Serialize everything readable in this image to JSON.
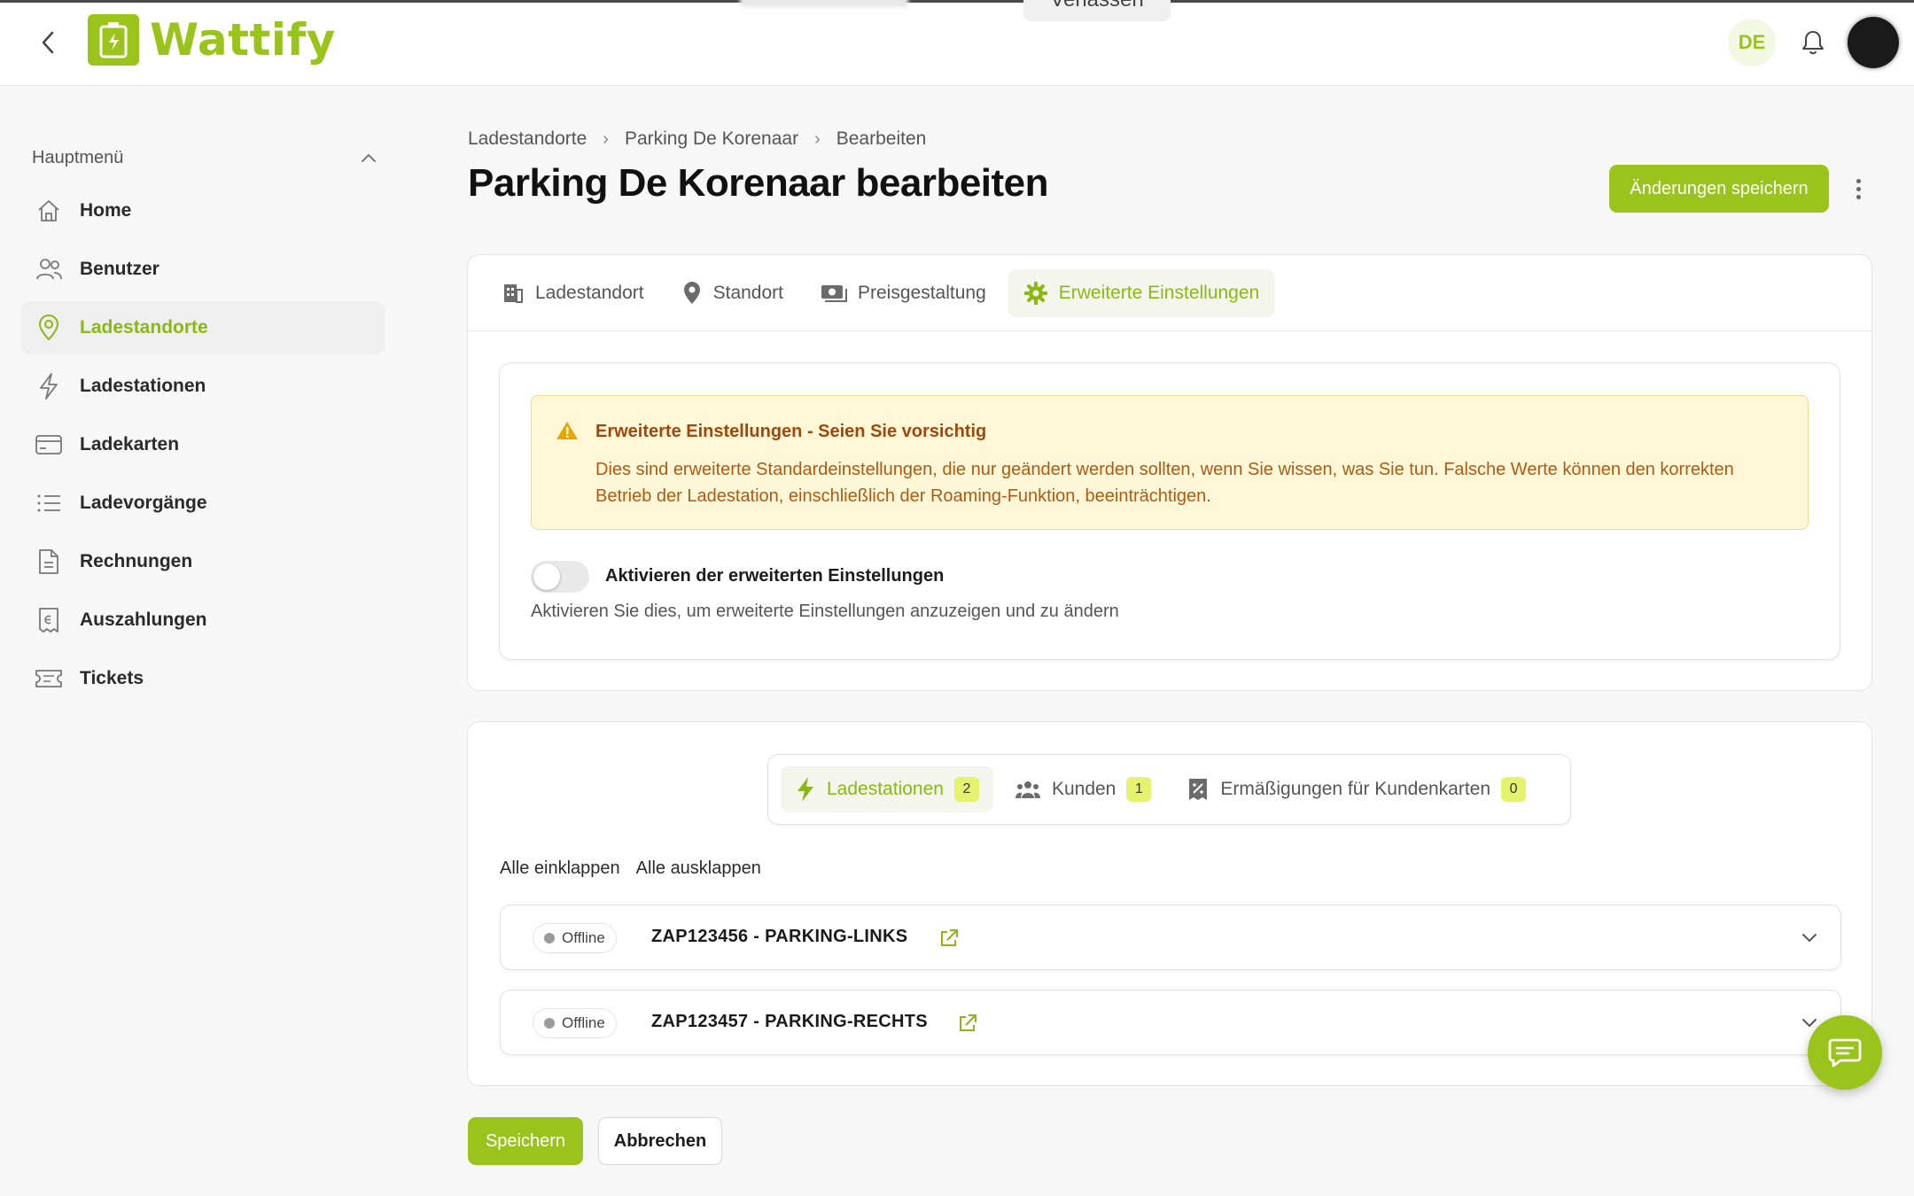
{
  "app": {
    "name": "Wattify",
    "language": "DE"
  },
  "header": {
    "ghost_button_label": "Verlassen"
  },
  "sidebar": {
    "section_title": "Hauptmenü",
    "items": [
      {
        "label": "Home",
        "icon": "home-icon"
      },
      {
        "label": "Benutzer",
        "icon": "users-icon"
      },
      {
        "label": "Ladestandorte",
        "icon": "location-pin-icon",
        "active": true
      },
      {
        "label": "Ladestationen",
        "icon": "lightning-icon"
      },
      {
        "label": "Ladekarten",
        "icon": "card-icon"
      },
      {
        "label": "Ladevorgänge",
        "icon": "list-icon"
      },
      {
        "label": "Rechnungen",
        "icon": "document-icon"
      },
      {
        "label": "Auszahlungen",
        "icon": "receipt-icon"
      },
      {
        "label": "Tickets",
        "icon": "ticket-icon"
      }
    ]
  },
  "breadcrumb": [
    "Ladestandorte",
    "Parking De Korenaar",
    "Bearbeiten"
  ],
  "page": {
    "title": "Parking De Korenaar bearbeiten",
    "save_changes_label": "Änderungen speichern"
  },
  "tabs": [
    {
      "label": "Ladestandort",
      "icon": "building-icon"
    },
    {
      "label": "Standort",
      "icon": "map-pin-icon"
    },
    {
      "label": "Preisgestaltung",
      "icon": "money-icon"
    },
    {
      "label": "Erweiterte Einstellungen",
      "icon": "gear-icon",
      "active": true
    }
  ],
  "advanced": {
    "alert_title": "Erweiterte Einstellungen - Seien Sie vorsichtig",
    "alert_text": "Dies sind erweiterte Standardeinstellungen, die nur geändert werden sollten, wenn Sie wissen, was Sie tun. Falsche Werte können den korrekten Betrieb der Ladestation, einschließlich der Roaming-Funktion, beeinträchtigen.",
    "toggle_label": "Aktivieren der erweiterten Einstellungen",
    "toggle_on": false,
    "toggle_help": "Aktivieren Sie dies, um erweiterte Einstellungen anzuzeigen und zu ändern"
  },
  "subtabs": [
    {
      "label": "Ladestationen",
      "count": "2",
      "icon": "lightning-icon",
      "active": true
    },
    {
      "label": "Kunden",
      "count": "1",
      "icon": "group-icon"
    },
    {
      "label": "Ermäßigungen für Kundenkarten",
      "count": "0",
      "icon": "discount-icon"
    }
  ],
  "collapse": {
    "collapse_all": "Alle einklappen",
    "expand_all": "Alle ausklappen"
  },
  "stations": [
    {
      "status": "Offline",
      "name": "ZAP123456 - PARKING-LINKS"
    },
    {
      "status": "Offline",
      "name": "ZAP123457 - PARKING-RECHTS"
    }
  ],
  "footer": {
    "save_label": "Speichern",
    "cancel_label": "Abbrechen"
  },
  "colors": {
    "accent": "#9ac31c",
    "alert_bg": "#fef7d8",
    "alert_text": "#b05a12",
    "badge": "#e4f26d"
  }
}
